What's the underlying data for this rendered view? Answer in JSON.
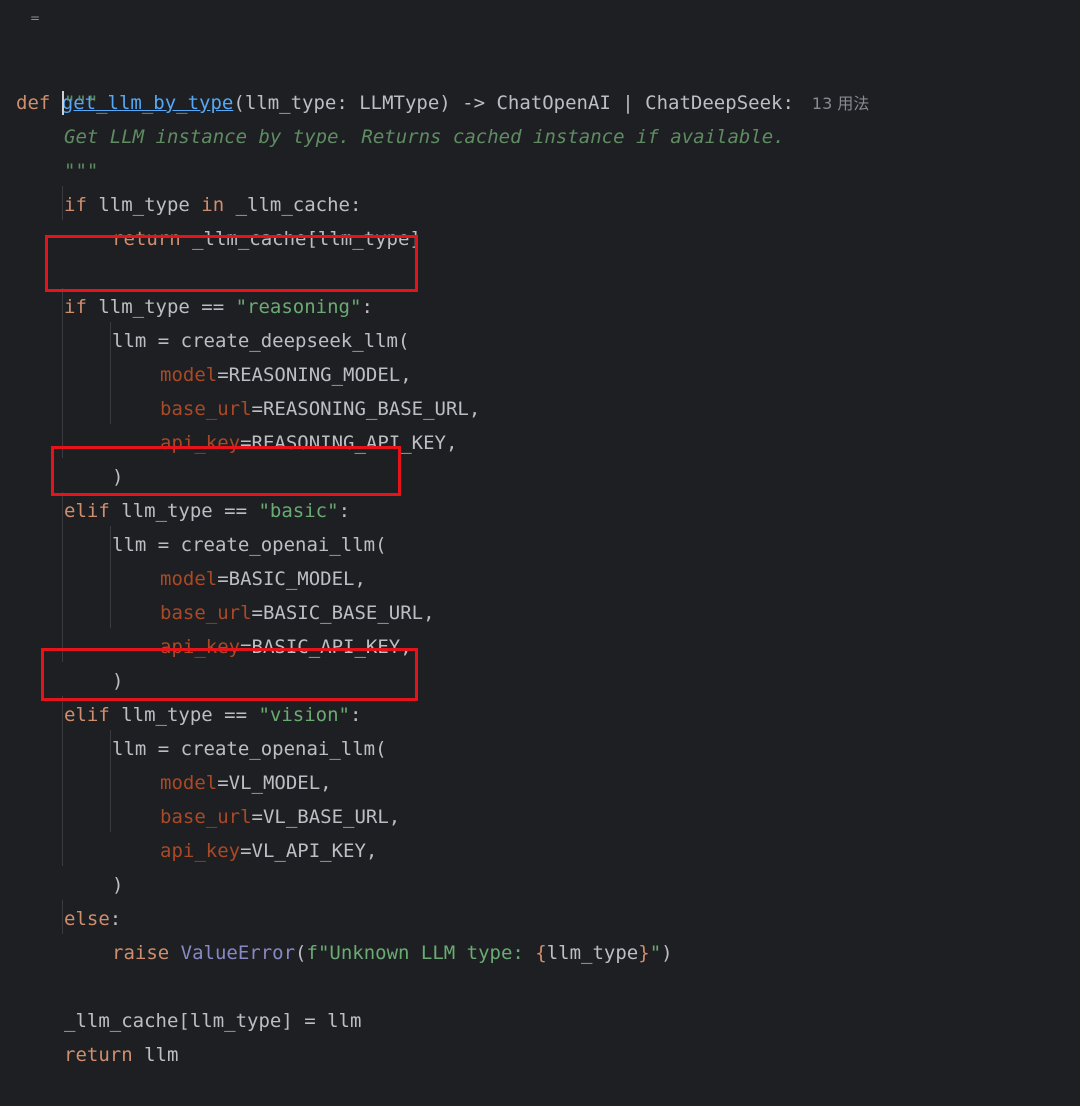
{
  "editor": {
    "fold_marker": "=",
    "usage_hint": "13 用法",
    "lines": [
      {
        "tokens": [
          "def",
          " ",
          "get_llm_by_type",
          "(llm_type: LLMType) -> ChatOpenAI | ChatDeepSeek:"
        ]
      },
      {
        "tokens": [
          "\"\"\""
        ]
      },
      {
        "tokens": [
          "Get LLM instance by type. Returns cached instance if available."
        ]
      },
      {
        "tokens": [
          "\"\"\""
        ]
      },
      {
        "tokens": [
          "if",
          " llm_type ",
          "in",
          " _llm_cache:"
        ]
      },
      {
        "tokens": [
          "return",
          " _llm_cache[llm_type]"
        ]
      },
      {
        "tokens": []
      },
      {
        "tokens": [
          "if",
          " llm_type == ",
          "\"reasoning\"",
          ":"
        ]
      },
      {
        "tokens": [
          "llm = create_deepseek_llm("
        ]
      },
      {
        "tokens": [
          "model",
          "=REASONING_MODEL,"
        ]
      },
      {
        "tokens": [
          "base_url",
          "=REASONING_BASE_URL,"
        ]
      },
      {
        "tokens": [
          "api_key",
          "=REASONING_API_KEY,"
        ]
      },
      {
        "tokens": [
          ")"
        ]
      },
      {
        "tokens": [
          "elif",
          " llm_type == ",
          "\"basic\"",
          ":"
        ]
      },
      {
        "tokens": [
          "llm = create_openai_llm("
        ]
      },
      {
        "tokens": [
          "model",
          "=BASIC_MODEL,"
        ]
      },
      {
        "tokens": [
          "base_url",
          "=BASIC_BASE_URL,"
        ]
      },
      {
        "tokens": [
          "api_key",
          "=BASIC_API_KEY,"
        ]
      },
      {
        "tokens": [
          ")"
        ]
      },
      {
        "tokens": [
          "elif",
          " llm_type == ",
          "\"vision\"",
          ":"
        ]
      },
      {
        "tokens": [
          "llm = create_openai_llm("
        ]
      },
      {
        "tokens": [
          "model",
          "=VL_MODEL,"
        ]
      },
      {
        "tokens": [
          "base_url",
          "=VL_BASE_URL,"
        ]
      },
      {
        "tokens": [
          "api_key",
          "=VL_API_KEY,"
        ]
      },
      {
        "tokens": [
          ")"
        ]
      },
      {
        "tokens": [
          "else",
          ":"
        ]
      },
      {
        "tokens": [
          "raise",
          " ",
          "ValueError",
          "(",
          "f\"Unknown LLM type: ",
          "{",
          "llm_type",
          "}",
          "\"",
          ")"
        ]
      },
      {
        "tokens": []
      },
      {
        "tokens": [
          "_llm_cache[llm_type] = llm"
        ]
      },
      {
        "tokens": [
          "return",
          " llm"
        ]
      }
    ]
  },
  "colors": {
    "background": "#1e1f22",
    "keyword": "#cf8e6d",
    "function": "#56a8f5",
    "string": "#6aab73",
    "docstring": "#5f8c63",
    "parameter": "#aa4926",
    "class": "#8888c6",
    "text": "#bcbec4",
    "highlight_box": "#e5141a"
  }
}
